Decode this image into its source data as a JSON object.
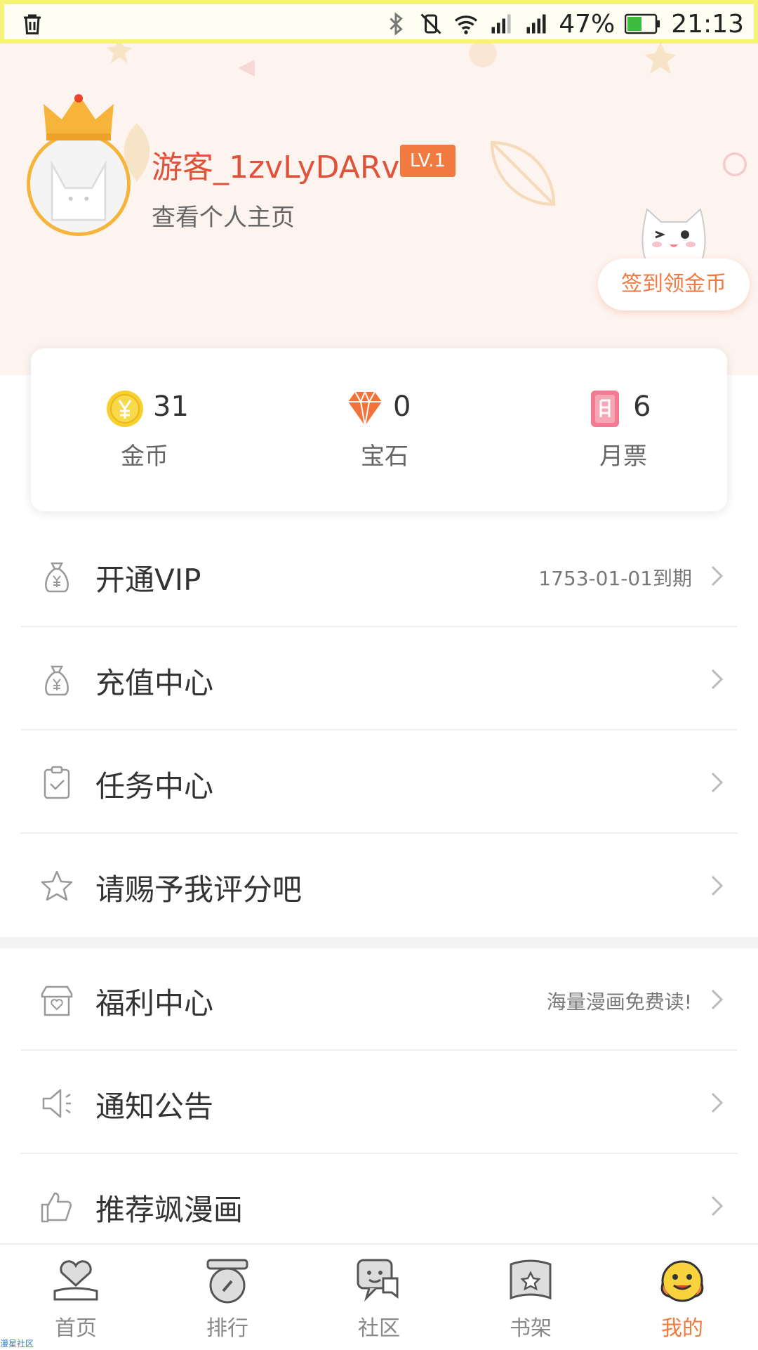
{
  "status_bar": {
    "battery": "47%",
    "time": "21:13",
    "accent": "#f6f27a"
  },
  "profile": {
    "username": "游客_1zvLyDARv",
    "level": "LV.1",
    "view_profile": "查看个人主页",
    "checkin_button": "签到领金币"
  },
  "stats": [
    {
      "value": "31",
      "label": "金币",
      "icon": "gold-coin-icon"
    },
    {
      "value": "0",
      "label": "宝石",
      "icon": "gem-icon"
    },
    {
      "value": "6",
      "label": "月票",
      "icon": "monthly-ticket-icon"
    }
  ],
  "menu": [
    {
      "label": "开通VIP",
      "extra": "1753-01-01到期",
      "icon": "money-bag-icon"
    },
    {
      "label": "充值中心",
      "extra": "",
      "icon": "money-bag-icon"
    },
    {
      "label": "任务中心",
      "extra": "",
      "icon": "clipboard-icon"
    },
    {
      "label": "请赐予我评分吧",
      "extra": "",
      "icon": "star-icon"
    },
    {
      "label": "福利中心",
      "extra": "海量漫画免费读!",
      "icon": "shop-icon"
    },
    {
      "label": "通知公告",
      "extra": "",
      "icon": "speaker-icon"
    },
    {
      "label": "推荐飒漫画",
      "extra": "",
      "icon": "thumbs-up-icon"
    }
  ],
  "tabs": [
    {
      "label": "首页",
      "icon": "home-heart-icon"
    },
    {
      "label": "排行",
      "icon": "ranking-icon"
    },
    {
      "label": "社区",
      "icon": "community-icon"
    },
    {
      "label": "书架",
      "icon": "bookshelf-icon"
    },
    {
      "label": "我的",
      "icon": "smiley-icon"
    }
  ],
  "watermark": "漫星社区",
  "colors": {
    "accent_orange": "#f07a3f",
    "username_red": "#e0533a",
    "header_bg": "#fdf3ef",
    "crown_gold": "#f6b43b"
  }
}
